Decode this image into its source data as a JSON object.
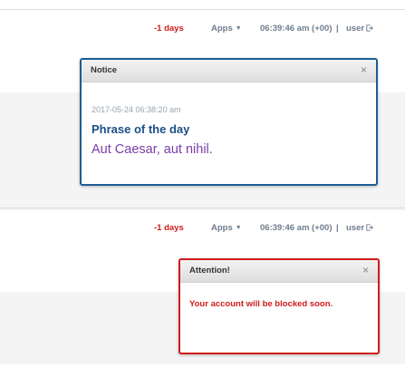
{
  "panel1": {
    "topbar": {
      "days": "-1 days",
      "apps": "Apps",
      "time": "06:39:46 am (+00)",
      "separator": "|",
      "user": "user",
      "user_icon": "logout-icon",
      "apps_icon": "caret-down-icon"
    },
    "dialog": {
      "title": "Notice",
      "close": "×",
      "date": "2017-05-24 06:38:20 am",
      "phrase_title": "Phrase of the day",
      "phrase": "Aut Caesar, aut nihil.",
      "border_color": "#1e5c95"
    }
  },
  "panel2": {
    "topbar": {
      "days": "-1 days",
      "apps": "Apps",
      "time": "06:39:46 am (+00)",
      "separator": "|",
      "user": "user",
      "user_icon": "logout-icon",
      "apps_icon": "caret-down-icon"
    },
    "dialog": {
      "title": "Attention!",
      "close": "×",
      "message": "Your account will be blocked soon.",
      "border_color": "#d11a1a"
    }
  }
}
